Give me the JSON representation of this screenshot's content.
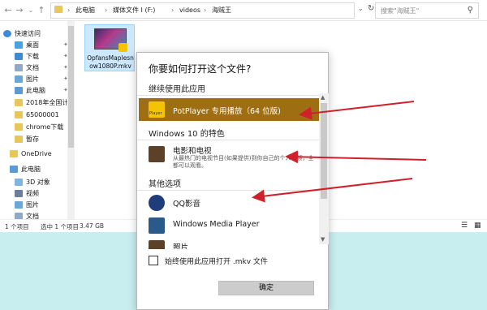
{
  "explorer": {
    "nav": {
      "back": "←",
      "forward": "→",
      "recent": "⌄",
      "up": "↑"
    },
    "breadcrumb": [
      "此电脑",
      "媒体文件 I (F:)",
      "videos",
      "海贼王"
    ],
    "search_placeholder": "搜索\"海贼王\"",
    "sidebar": {
      "items": [
        {
          "label": "快速访问",
          "icon": "star-icon",
          "pinned": false
        },
        {
          "label": "桌面",
          "icon": "desktop-icon",
          "pinned": true
        },
        {
          "label": "下载",
          "icon": "download-icon",
          "pinned": true
        },
        {
          "label": "文档",
          "icon": "document-icon",
          "pinned": true
        },
        {
          "label": "图片",
          "icon": "picture-icon",
          "pinned": true
        },
        {
          "label": "此电脑",
          "icon": "computer-icon",
          "pinned": true
        },
        {
          "label": "2018年全国计算",
          "icon": "folder-icon",
          "pinned": false
        },
        {
          "label": "65000001",
          "icon": "folder-icon",
          "pinned": false
        },
        {
          "label": "chrome下载",
          "icon": "folder-icon",
          "pinned": false
        },
        {
          "label": "暂存",
          "icon": "folder-icon",
          "pinned": false
        },
        {
          "label": "OneDrive",
          "icon": "folder-icon",
          "pinned": false
        },
        {
          "label": "此电脑",
          "icon": "computer-icon",
          "pinned": false
        },
        {
          "label": "3D 对象",
          "icon": "cube-icon",
          "pinned": false
        },
        {
          "label": "视频",
          "icon": "video-icon",
          "pinned": false
        },
        {
          "label": "图片",
          "icon": "picture-icon",
          "pinned": false
        },
        {
          "label": "文档",
          "icon": "document-icon",
          "pinned": false
        }
      ]
    },
    "file": {
      "name_line1": "OpfansMaplesn",
      "name_line2": "ow1080P.mkv"
    },
    "status": {
      "count": "1 个项目",
      "selected": "选中 1 个项目",
      "size": "3.47 GB"
    }
  },
  "dialog": {
    "title": "你要如何打开这个文件?",
    "section_continue": "继续使用此应用",
    "section_win10": "Windows 10 的特色",
    "section_other": "其他选项",
    "apps": {
      "potplayer": {
        "name": "PotPlayer 专用播放（64 位版)",
        "badge": "Player"
      },
      "movies": {
        "name": "电影和电视",
        "desc": "从最热门的电视节目(如果提供)到你自己的个人视频，全都可以观看。"
      },
      "qq": {
        "name": "QQ影音"
      },
      "wmp": {
        "name": "Windows Media Player"
      },
      "photos": {
        "name": "照片"
      }
    },
    "always_use": "始终使用此应用打开 .mkv 文件",
    "ok_label": "确定"
  },
  "colors": {
    "selected_row": "#9e6f12",
    "arrow": "#d0202a",
    "background": "#c8eef0"
  }
}
